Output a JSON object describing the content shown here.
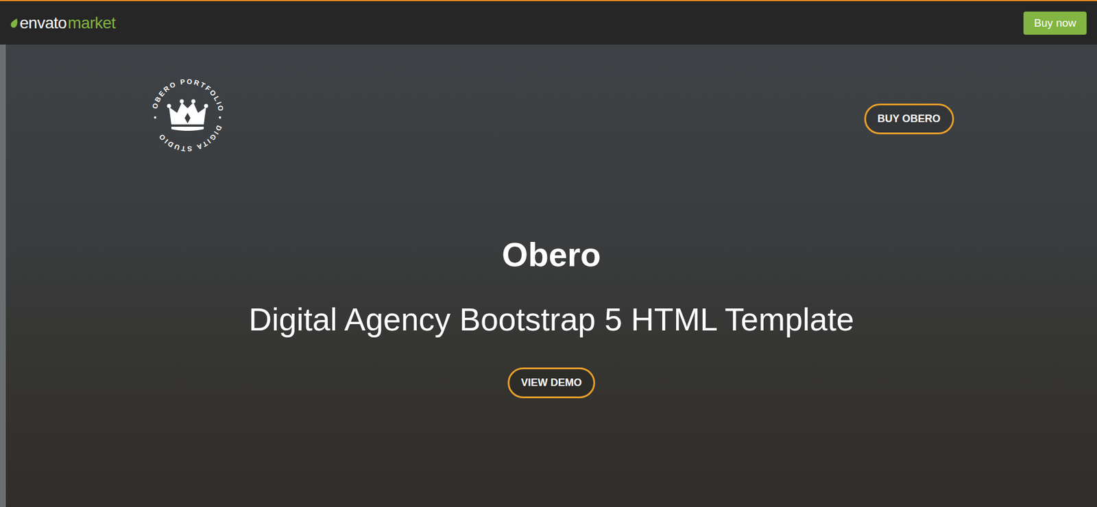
{
  "topbar": {
    "brand": {
      "part1": "envato",
      "part2": "market"
    },
    "buy_button": "Buy now"
  },
  "hero": {
    "logo": {
      "top_text": "OBERO PORTFOLIO",
      "bottom_text": "DIGITA STUDIO"
    },
    "buy_button": "BUY OBERO",
    "title": "Obero",
    "subtitle": "Digital Agency Bootstrap 5 HTML Template",
    "demo_button": "VIEW DEMO"
  }
}
